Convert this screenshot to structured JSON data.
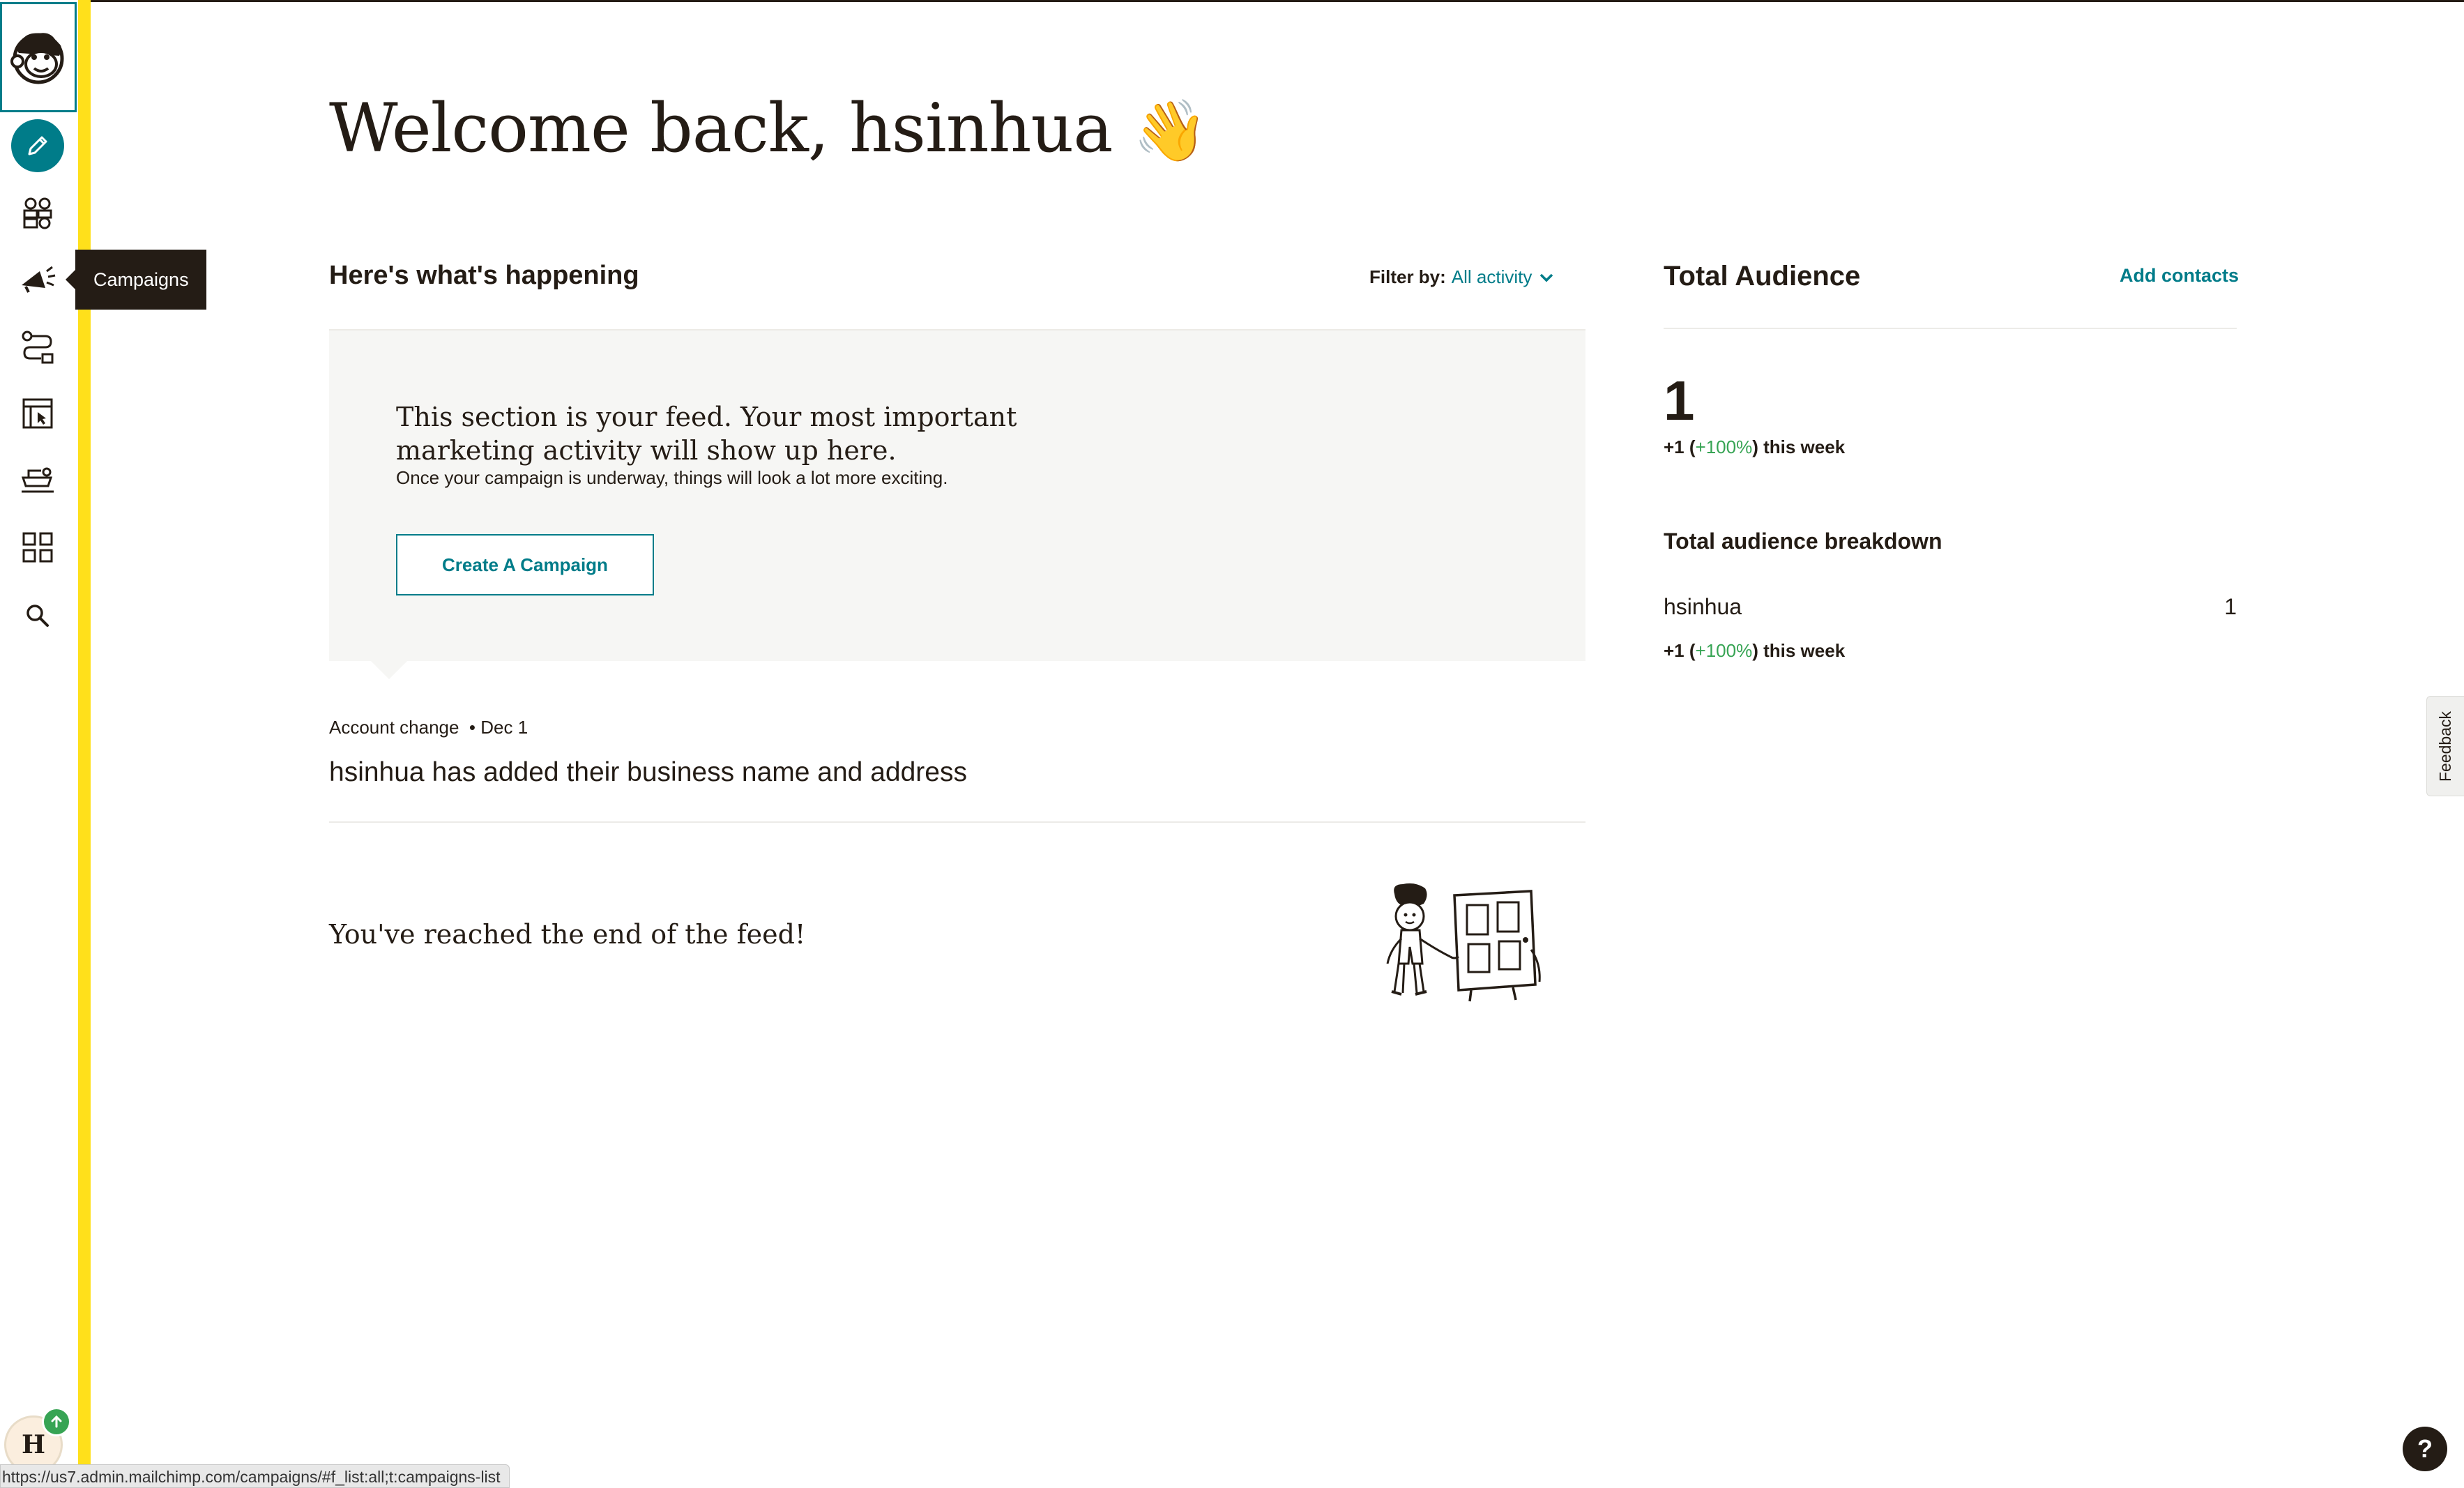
{
  "sidebar": {
    "logo_name": "mailchimp-freddie-logo",
    "items": [
      {
        "name": "create",
        "icon": "pencil-icon",
        "active": true
      },
      {
        "name": "audience",
        "icon": "audience-icon"
      },
      {
        "name": "campaigns",
        "icon": "megaphone-icon"
      },
      {
        "name": "automations",
        "icon": "automation-icon"
      },
      {
        "name": "website",
        "icon": "website-icon"
      },
      {
        "name": "content",
        "icon": "integrations-icon"
      },
      {
        "name": "dashboard",
        "icon": "grid-icon"
      },
      {
        "name": "search",
        "icon": "search-icon"
      }
    ],
    "tooltip": "Campaigns",
    "avatar_initial": "H"
  },
  "welcome": {
    "title": "Welcome back, hsinhua",
    "emoji": "👋"
  },
  "feed": {
    "section_title": "Here's what's happening",
    "filter_label": "Filter by:",
    "filter_value": "All activity",
    "empty_headline": "This section is your feed. Your most important marketing activity will show up here.",
    "empty_sub": "Once your campaign is underway, things will look a lot more exciting.",
    "create_button": "Create A Campaign",
    "activity": {
      "type": "Account change",
      "date": "• Dec 1",
      "text": "hsinhua has added their business name and address"
    },
    "end_text": "You've reached the end of the feed!"
  },
  "audience": {
    "title": "Total Audience",
    "add_contacts": "Add contacts",
    "count": "1",
    "change_prefix": "+1 (",
    "change_pct": "+100%",
    "change_suffix": ") this week",
    "breakdown_title": "Total audience breakdown",
    "breakdown": [
      {
        "name": "hsinhua",
        "value": "1",
        "change_prefix": "+1 (",
        "change_pct": "+100%",
        "change_suffix": ") this week"
      }
    ]
  },
  "feedback_tab": "Feedback",
  "help_button": "?",
  "status_url": "https://us7.admin.mailchimp.com/campaigns/#f_list:all;t:campaigns-list",
  "colors": {
    "accent": "#007c89",
    "yellow": "#ffe01b",
    "text": "#241c15",
    "green": "#37a454",
    "panel": "#f6f6f4"
  }
}
